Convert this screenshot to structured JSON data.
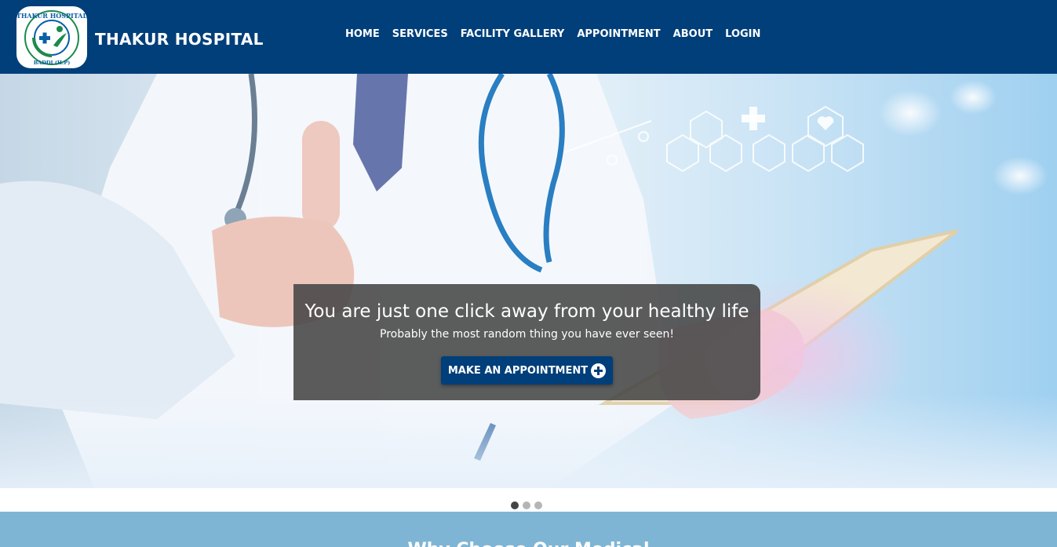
{
  "header": {
    "brand": "THAKUR HOSPITAL",
    "logo_text_top": "THAKUR HOSPITAL",
    "logo_text_bottom": "BADDI (H.P)",
    "background_color": "#003f7a"
  },
  "nav": {
    "items": [
      {
        "label": "HOME"
      },
      {
        "label": "SERVICES"
      },
      {
        "label": "FACILITY GALLERY"
      },
      {
        "label": "APPOINTMENT"
      },
      {
        "label": "ABOUT"
      },
      {
        "label": "LOGIN"
      }
    ]
  },
  "hero": {
    "title": "You are just one click away from your healthy life",
    "subtitle": "Probably the most random thing you have ever seen!",
    "cta_label": "MAKE AN APPOINTMENT",
    "cta_icon": "plus-circle-icon"
  },
  "carousel": {
    "slide_count": 3,
    "active_index": 0
  },
  "why": {
    "title": "Why Choose Our Medical"
  }
}
